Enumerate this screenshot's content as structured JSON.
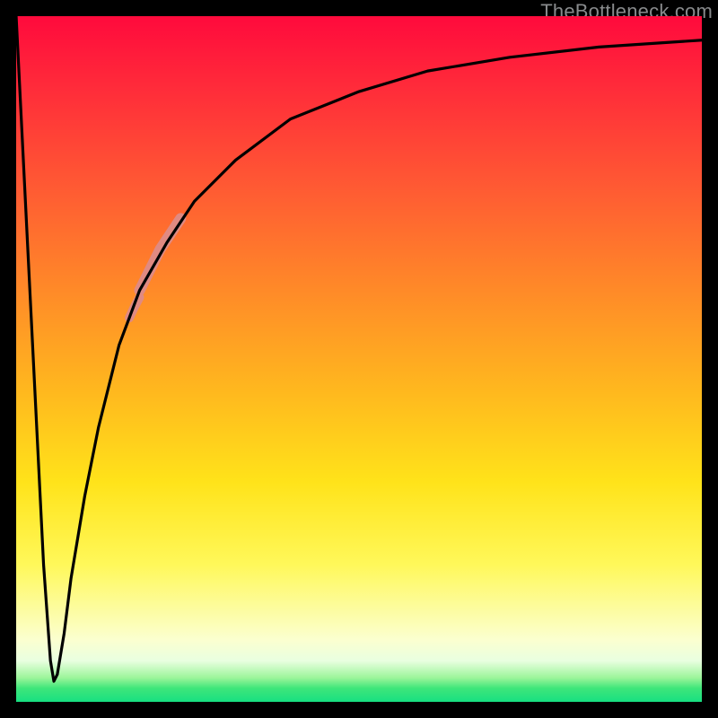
{
  "watermark": "TheBottleneck.com",
  "chart_data": {
    "type": "line",
    "title": "",
    "xlabel": "",
    "ylabel": "",
    "xlim": [
      0,
      100
    ],
    "ylim": [
      0,
      100
    ],
    "grid": false,
    "legend": false,
    "background_gradient": {
      "direction": "vertical",
      "stops": [
        {
          "pos": 0,
          "color": "#ff0a3c"
        },
        {
          "pos": 25,
          "color": "#ff5a33"
        },
        {
          "pos": 55,
          "color": "#ffb91e"
        },
        {
          "pos": 80,
          "color": "#fff85a"
        },
        {
          "pos": 94,
          "color": "#e9ffe0"
        },
        {
          "pos": 100,
          "color": "#17e081"
        }
      ]
    },
    "series": [
      {
        "name": "bottleneck-curve",
        "color": "#000000",
        "x": [
          0,
          2,
          4,
          5,
          5.5,
          6,
          7,
          8,
          10,
          12,
          15,
          18,
          22,
          26,
          32,
          40,
          50,
          60,
          72,
          85,
          100
        ],
        "y": [
          100,
          60,
          20,
          6,
          3,
          4,
          10,
          18,
          30,
          40,
          52,
          60,
          67,
          73,
          79,
          85,
          89,
          92,
          94,
          95.5,
          96.5
        ]
      }
    ],
    "highlights": [
      {
        "name": "highlight-upper",
        "color": "#e08a82",
        "thickness": 12,
        "x": [
          18,
          19,
          20,
          21,
          22,
          23,
          24
        ],
        "y": [
          60,
          62,
          64,
          66,
          67.5,
          69,
          70.5
        ]
      },
      {
        "name": "highlight-lower",
        "color": "#e08a82",
        "thickness": 10,
        "x": [
          16.5,
          17.2,
          18
        ],
        "y": [
          56,
          57.5,
          59
        ]
      }
    ]
  }
}
